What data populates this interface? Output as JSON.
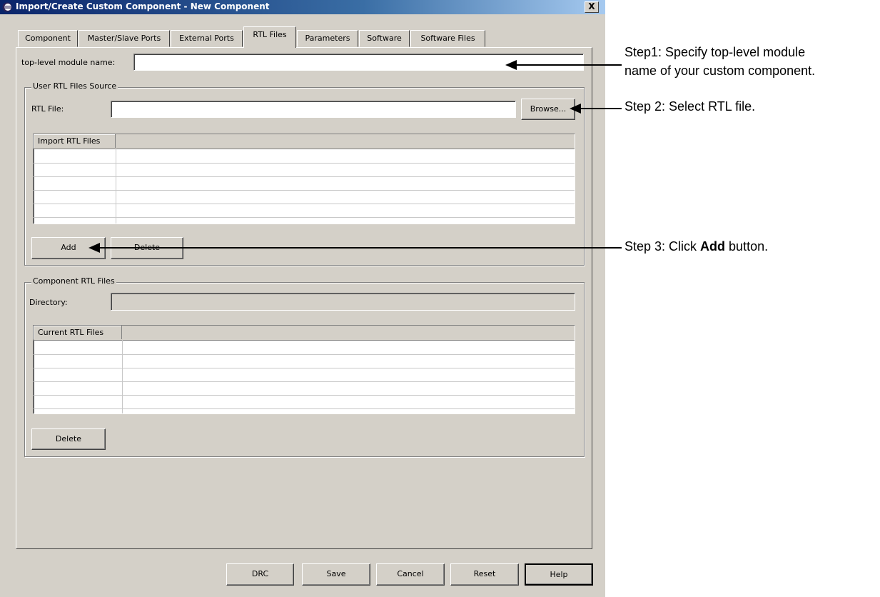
{
  "window": {
    "title": "Import/Create Custom Component - New Component",
    "close_label": "X"
  },
  "tabs": [
    {
      "label": "Component"
    },
    {
      "label": "Master/Slave Ports"
    },
    {
      "label": "External Ports"
    },
    {
      "label": "RTL Files",
      "selected": true
    },
    {
      "label": "Parameters"
    },
    {
      "label": "Software"
    },
    {
      "label": "Software Files"
    }
  ],
  "top_module": {
    "label": "top-level module name:",
    "value": ""
  },
  "user_rtl": {
    "legend": "User RTL Files Source",
    "rtl_file_label": "RTL File:",
    "rtl_file_value": "",
    "browse_label": "Browse...",
    "table_header": "Import RTL Files",
    "rows": [
      "",
      "",
      "",
      "",
      ""
    ],
    "add_label": "Add",
    "delete_label": "Delete"
  },
  "component_rtl": {
    "legend": "Component RTL Files",
    "directory_label": "Directory:",
    "directory_value": "",
    "table_header": "Current RTL Files",
    "rows": [
      "",
      "",
      "",
      "",
      ""
    ],
    "delete_label": "Delete"
  },
  "footer_buttons": {
    "drc": "DRC",
    "save": "Save",
    "cancel": "Cancel",
    "reset": "Reset",
    "help": "Help"
  },
  "annotations": {
    "step1_line1": "Step1: Specify top-level module",
    "step1_line2": "name of your custom component.",
    "step2": "Step 2: Select RTL file.",
    "step3_prefix": "Step 3: Click ",
    "step3_bold": "Add",
    "step3_suffix": " button."
  },
  "colors": {
    "dialog_bg": "#d4d0c8",
    "titlebar_start": "#0a246a",
    "titlebar_end": "#a6caf0"
  }
}
